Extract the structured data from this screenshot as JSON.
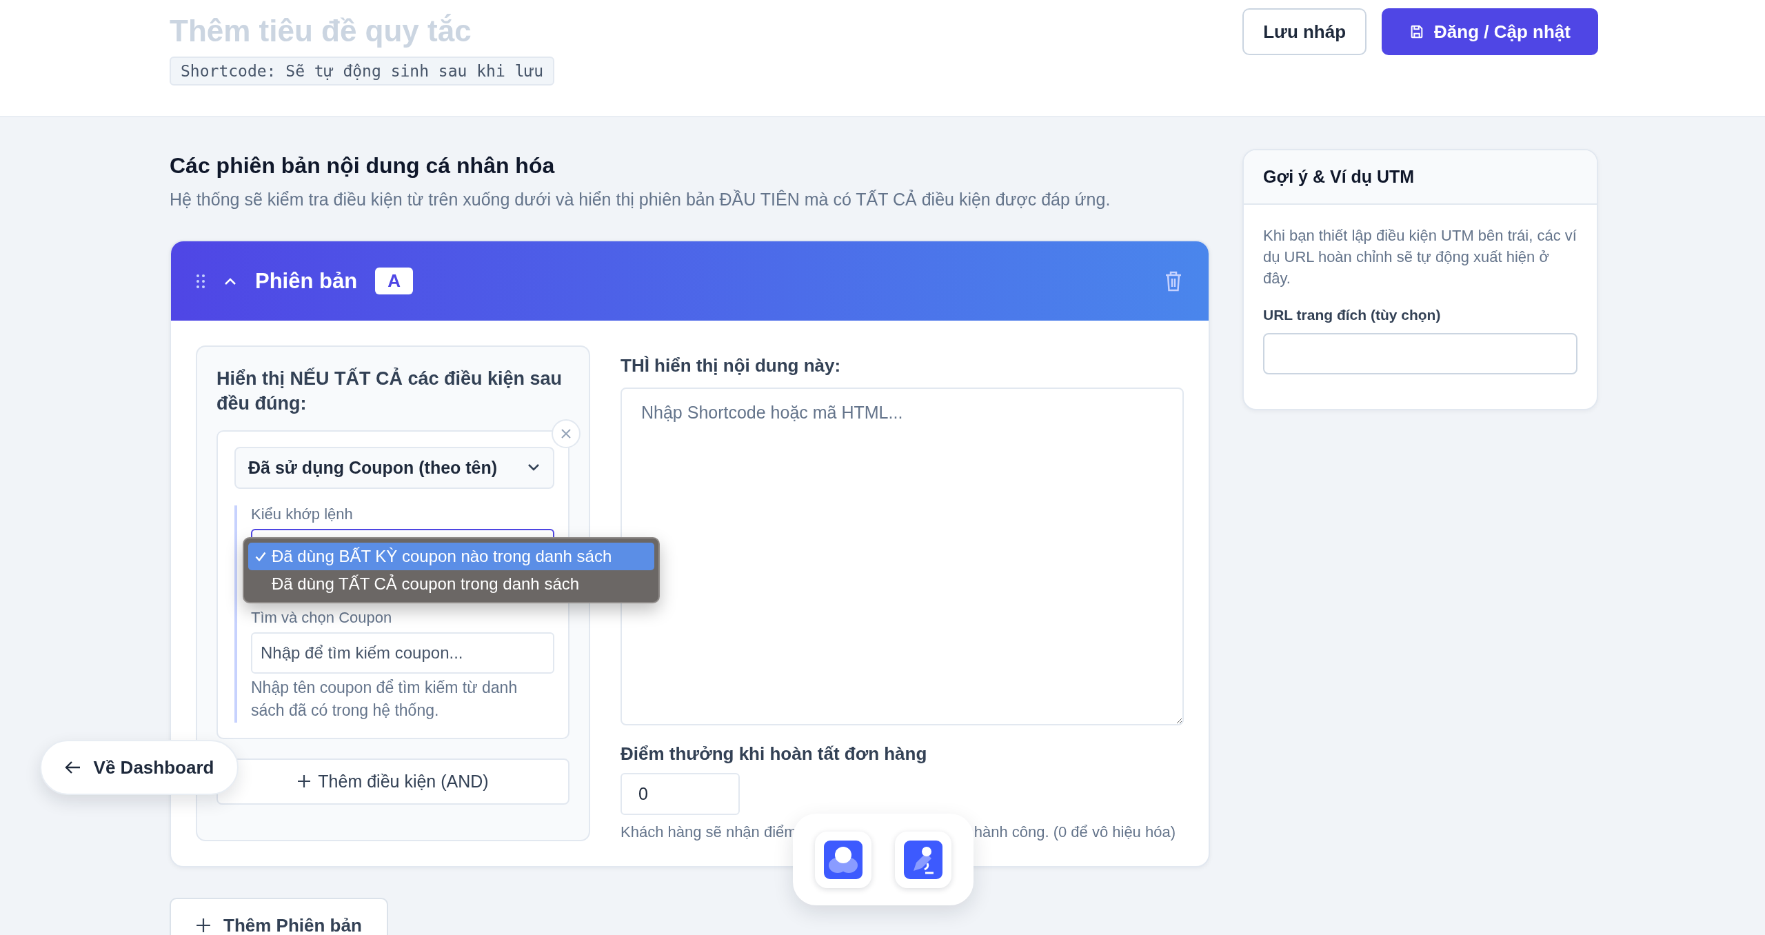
{
  "header": {
    "title_placeholder": "Thêm tiêu đề quy tắc",
    "shortcode": "Shortcode: Sẽ tự động sinh sau khi lưu",
    "buttons": [
      {
        "label": "Lưu nháp",
        "kind": "secondary"
      },
      {
        "label": "Đăng / Cập nhật",
        "kind": "primary"
      }
    ]
  },
  "section": {
    "title": "Các phiên bản nội dung cá nhân hóa",
    "description": "Hệ thống sẽ kiểm tra điều kiện từ trên xuống dưới và hiển thị phiên bản ĐẦU TIÊN mà có TẤT CẢ điều kiện được đáp ứng."
  },
  "versions": [
    {
      "label": "Phiên bản",
      "badge": "A",
      "expanded": true,
      "conditions_title": "Hiển thị NẾU TẤT CẢ các điều kiện sau đều đúng:",
      "conditions": [
        {
          "type": "Đã sử dụng Coupon (theo tên)",
          "match_label": "Kiểu khớp lệnh",
          "match_options": [
            {
              "label": "Đã dùng BẤT KỲ coupon nào trong danh sách",
              "selected": true
            },
            {
              "label": "Đã dùng TẤT CẢ coupon trong danh sách",
              "selected": false
            }
          ],
          "coupon_label": "Tìm và chọn Coupon",
          "coupon_placeholder": "Nhập để tìm kiếm coupon...",
          "coupon_help": "Nhập tên coupon để tìm kiếm từ danh sách đã có trong hệ thống."
        }
      ],
      "add_condition": "Thêm điều kiện (AND)",
      "content_label": "THÌ hiển thị nội dung này:",
      "content_placeholder": "Nhập Shortcode hoặc mã HTML...",
      "points_label": "Điểm thưởng khi hoàn tất đơn hàng",
      "points_value": "0",
      "points_help": [
        "Khách hàng sẽ nhận điểm",
        "hành công. (0 để vô hiệu hóa)"
      ]
    }
  ],
  "add_version": "Thêm Phiên bản",
  "sidebar": {
    "title": "Gợi ý & Ví dụ UTM",
    "text": "Khi bạn thiết lập điều kiện UTM bên trái, các ví dụ URL hoàn chỉnh sẽ tự động xuất hiện ở đây.",
    "url_label": "URL trang đích (tùy chọn)"
  },
  "back_button": "Về Dashboard"
}
